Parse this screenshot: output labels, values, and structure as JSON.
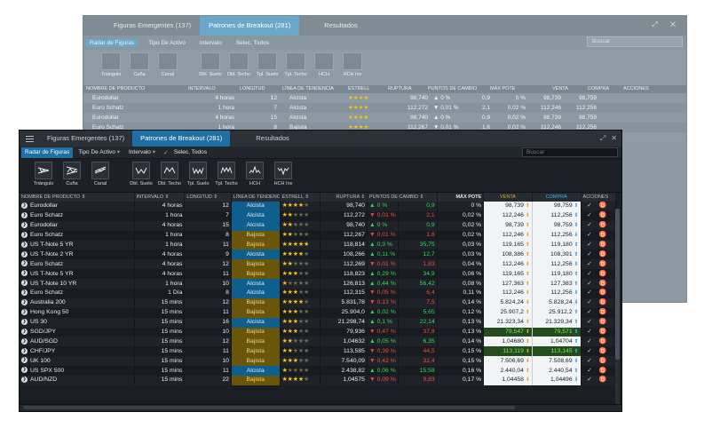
{
  "tabs": [
    {
      "label": "Figuras Emergentes (137)"
    },
    {
      "label": "Patrones de Breakout (281)"
    },
    {
      "label": "Resultados"
    }
  ],
  "toolbar": {
    "radar": "Radar de Figuras",
    "tipo": "Tipo De Activo",
    "intervalo": "Intervalo",
    "selec": "Selec. Todos",
    "caret": "▾",
    "check": "✓"
  },
  "search": {
    "placeholder": "Buscar"
  },
  "patterns": [
    {
      "label": "Triángulo",
      "icon": "triangle-pattern-icon"
    },
    {
      "label": "Cuña",
      "icon": "wedge-pattern-icon"
    },
    {
      "label": "Canal",
      "icon": "channel-pattern-icon"
    },
    {
      "label": "Dbl. Suelo",
      "icon": "double-bottom-icon"
    },
    {
      "label": "Dbl. Techo",
      "icon": "double-top-icon"
    },
    {
      "label": "Tpl. Suelo",
      "icon": "triple-bottom-icon"
    },
    {
      "label": "Tpl. Techo",
      "icon": "triple-top-icon"
    },
    {
      "label": "HCH",
      "icon": "head-shoulders-icon"
    },
    {
      "label": "HCH Inv",
      "icon": "inverse-head-shoulders-icon"
    }
  ],
  "columns": {
    "producto": "NOMBRE DE PRODUCTO",
    "intervalo": "INTERVALO",
    "longitud": "LONGITUD",
    "tendencia": "LÍNEA DE TENDENCIA",
    "estrellas": "ESTRELL",
    "ruptura": "RUPTURA",
    "puntos": "PUNTOS DE CAMBIO",
    "maxpot": "MÁX POTE",
    "venta": "VENTA",
    "compra": "COMPRA",
    "acciones": "ACCIONES"
  },
  "colors": {
    "accent": "#1e6fa3",
    "alcista": "#0f5f8e",
    "bajista": "#6a560b",
    "positive": "#37d35a",
    "negative": "#f04747",
    "venta_arrow": "#e3a43a",
    "compra_arrow": "#3aa6e3"
  },
  "sort_glyph": "⇕",
  "row_icon": "❯",
  "action_glyphs": "✓ ♉",
  "rows": [
    {
      "producto": "Eurodollar",
      "intervalo": "4 horas",
      "longitud": "12",
      "tendencia": "Alcista",
      "estrellas": 4,
      "ruptura": "98,740",
      "cambio": "▲ 0 %",
      "puntos": "0,9",
      "maxpot": "0 %",
      "venta": "98,739",
      "compra": "98,759",
      "dir": "up"
    },
    {
      "producto": "Euro Schatz",
      "intervalo": "1 hora",
      "longitud": "7",
      "tendencia": "Alcista",
      "estrellas": 2,
      "ruptura": "112,272",
      "cambio": "▼ 0,01 %",
      "puntos": "2,1",
      "maxpot": "0,02 %",
      "venta": "112,246",
      "compra": "112,256",
      "dir": "down"
    },
    {
      "producto": "Eurodollar",
      "intervalo": "4 horas",
      "longitud": "15",
      "tendencia": "Alcista",
      "estrellas": 2,
      "ruptura": "98,740",
      "cambio": "▲ 0 %",
      "puntos": "0,9",
      "maxpot": "0,02 %",
      "venta": "98,739",
      "compra": "98,759",
      "dir": "up"
    },
    {
      "producto": "Euro Schatz",
      "intervalo": "1 hora",
      "longitud": "8",
      "tendencia": "Bajista",
      "estrellas": 2,
      "ruptura": "112,267",
      "cambio": "▼ 0,01 %",
      "puntos": "1,6",
      "maxpot": "0,02 %",
      "venta": "112,246",
      "compra": "112,256",
      "dir": "down"
    },
    {
      "producto": "US T-Note 5 YR",
      "intervalo": "1 hora",
      "longitud": "11",
      "tendencia": "Bajista",
      "estrellas": 5,
      "ruptura": "118,814",
      "cambio": "▲ 0,3 %",
      "puntos": "35,75",
      "maxpot": "0,03 %",
      "venta": "119,165",
      "compra": "119,180",
      "dir": "up"
    },
    {
      "producto": "US T-Note 2 YR",
      "intervalo": "4 horas",
      "longitud": "9",
      "tendencia": "Alcista",
      "estrellas": 4,
      "ruptura": "108,266",
      "cambio": "▲ 0,11 %",
      "puntos": "12,7",
      "maxpot": "0,03 %",
      "venta": "108,386",
      "compra": "108,391",
      "dir": "up"
    },
    {
      "producto": "Euro Schatz",
      "intervalo": "4 horas",
      "longitud": "12",
      "tendencia": "Bajista",
      "estrellas": 2,
      "ruptura": "112,269",
      "cambio": "▼ 0,01 %",
      "puntos": "1,83",
      "maxpot": "0,04 %",
      "venta": "112,246",
      "compra": "112,256",
      "dir": "down"
    },
    {
      "producto": "US T-Note 5 YR",
      "intervalo": "4 horas",
      "longitud": "11",
      "tendencia": "Bajista",
      "estrellas": 3,
      "ruptura": "118,823",
      "cambio": "▲ 0,29 %",
      "puntos": "34,9",
      "maxpot": "0,06 %",
      "venta": "119,165",
      "compra": "119,180",
      "dir": "up"
    },
    {
      "producto": "US T-Note 10 YR",
      "intervalo": "1 hora",
      "longitud": "10",
      "tendencia": "Alcista",
      "estrellas": 1,
      "ruptura": "126,813",
      "cambio": "▲ 0,44 %",
      "puntos": "56,42",
      "maxpot": "0,08 %",
      "venta": "127,363",
      "compra": "127,383",
      "dir": "up"
    },
    {
      "producto": "Euro Schatz",
      "intervalo": "1 Día",
      "longitud": "8",
      "tendencia": "Alcista",
      "estrellas": 3,
      "ruptura": "112,315",
      "cambio": "▼ 0,05 %",
      "puntos": "6,4",
      "maxpot": "0,11 %",
      "venta": "112,246",
      "compra": "112,256",
      "dir": "down"
    },
    {
      "producto": "Australia 200",
      "intervalo": "15 mins",
      "longitud": "12",
      "tendencia": "Bajista",
      "estrellas": 4,
      "ruptura": "5.831,78",
      "cambio": "▼ 0,13 %",
      "puntos": "7,5",
      "maxpot": "0,14 %",
      "venta": "5.824,24",
      "compra": "5.828,24",
      "dir": "down"
    },
    {
      "producto": "Hong Kong 50",
      "intervalo": "15 mins",
      "longitud": "11",
      "tendencia": "Bajista",
      "estrellas": 3,
      "ruptura": "25.904,0",
      "cambio": "▲ 0,02 %",
      "puntos": "5,65",
      "maxpot": "0,12 %",
      "venta": "25.907,2",
      "compra": "25.912,2",
      "dir": "up"
    },
    {
      "producto": "US 30",
      "intervalo": "15 mins",
      "longitud": "16",
      "tendencia": "Alcista",
      "estrellas": 3,
      "ruptura": "21.298,74",
      "cambio": "▲ 0,1 %",
      "puntos": "22,14",
      "maxpot": "0,13 %",
      "venta": "21.323,34",
      "compra": "21.329,34",
      "dir": "up"
    },
    {
      "producto": "SGD/JPY",
      "intervalo": "15 mins",
      "longitud": "10",
      "tendencia": "Bajista",
      "estrellas": 3,
      "ruptura": "79,936",
      "cambio": "▼ 0,47 %",
      "puntos": "37,8",
      "maxpot": "0,13 %",
      "venta": "79,547",
      "compra": "79,571",
      "dir": "up",
      "hl": true
    },
    {
      "producto": "AUD/SGD",
      "intervalo": "15 mins",
      "longitud": "12",
      "tendencia": "Bajista",
      "estrellas": 2,
      "ruptura": "1,04632",
      "cambio": "▲ 0,05 %",
      "puntos": "6,35",
      "maxpot": "0,14 %",
      "venta": "1,04680",
      "compra": "1,04704",
      "dir": "up"
    },
    {
      "producto": "CHF/JPY",
      "intervalo": "15 mins",
      "longitud": "11",
      "tendencia": "Bajista",
      "estrellas": 2,
      "ruptura": "113,585",
      "cambio": "▼ 0,39 %",
      "puntos": "44,5",
      "maxpot": "0,15 %",
      "venta": "113,119",
      "compra": "113,145",
      "dir": "up",
      "hl": true
    },
    {
      "producto": "UK 100",
      "intervalo": "15 mins",
      "longitud": "10",
      "tendencia": "Bajista",
      "estrellas": 3,
      "ruptura": "7.540,09",
      "cambio": "▼ 0,42 %",
      "puntos": "32,4",
      "maxpot": "0,15 %",
      "venta": "7.506,69",
      "compra": "7.508,69",
      "dir": "down"
    },
    {
      "producto": "US SPX 500",
      "intervalo": "15 mins",
      "longitud": "11",
      "tendencia": "Alcista",
      "estrellas": 1,
      "ruptura": "2.438,82",
      "cambio": "▲ 0,06 %",
      "puntos": "15,58",
      "maxpot": "0,16 %",
      "venta": "2.440,04",
      "compra": "2.440,54",
      "dir": "up"
    },
    {
      "producto": "AUD/NZD",
      "intervalo": "15 mins",
      "longitud": "22",
      "tendencia": "Bajista",
      "estrellas": 4,
      "ruptura": "1,04575",
      "cambio": "▼ 0,09 %",
      "puntos": "9,83",
      "maxpot": "0,17 %",
      "venta": "1,04458",
      "compra": "1,04496",
      "dir": "down"
    }
  ],
  "bg_rows": [
    {
      "producto": "Eurodollar",
      "intervalo": "4 horas",
      "longitud": "12",
      "tendencia": "Alcista",
      "ruptura": "98,740",
      "cambio": "▲ 0 %",
      "puntos": "0,9",
      "maxpot": "0 %",
      "venta": "98,739",
      "compra": "98,759"
    },
    {
      "producto": "Euro Schatz",
      "intervalo": "1 hora",
      "longitud": "7",
      "tendencia": "Alcista",
      "ruptura": "112,272",
      "cambio": "▼ 0,01 %",
      "puntos": "2,1",
      "maxpot": "0,02 %",
      "venta": "112,246",
      "compra": "112,256"
    },
    {
      "producto": "Eurodollar",
      "intervalo": "4 horas",
      "longitud": "15",
      "tendencia": "Alcista",
      "ruptura": "98,740",
      "cambio": "▲ 0 %",
      "puntos": "0,9",
      "maxpot": "0,02 %",
      "venta": "98,739",
      "compra": "98,759"
    },
    {
      "producto": "Euro Schatz",
      "intervalo": "1 hora",
      "longitud": "8",
      "tendencia": "Bajista",
      "ruptura": "112,267",
      "cambio": "▼ 0,01 %",
      "puntos": "1,6",
      "maxpot": "0,02 %",
      "venta": "112,246",
      "compra": "112,256"
    }
  ]
}
